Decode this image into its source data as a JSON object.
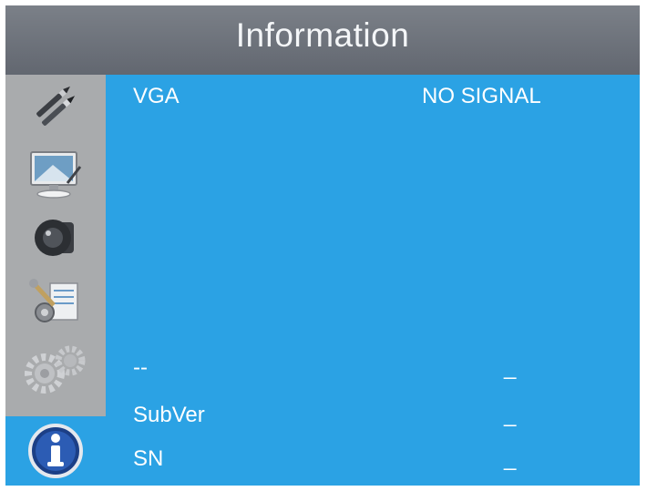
{
  "header": {
    "title": "Information"
  },
  "sidebar": {
    "items": [
      {
        "name": "picture",
        "icon": "pencil-brushes-icon"
      },
      {
        "name": "display",
        "icon": "monitor-icon"
      },
      {
        "name": "audio",
        "icon": "speaker-icon"
      },
      {
        "name": "setup",
        "icon": "tools-icon"
      },
      {
        "name": "advanced",
        "icon": "gears-icon"
      },
      {
        "name": "information",
        "icon": "info-icon",
        "active": true
      }
    ]
  },
  "info": {
    "rows": [
      {
        "label": "VGA",
        "value": "NO SIGNAL"
      },
      {
        "label": "--",
        "value": "_"
      },
      {
        "label": "SubVer",
        "value": "_"
      },
      {
        "label": "SN",
        "value": "_"
      }
    ]
  },
  "colors": {
    "accent": "#2ba2e4",
    "title_bar": "#6f747c",
    "sidebar": "#a9abad"
  }
}
